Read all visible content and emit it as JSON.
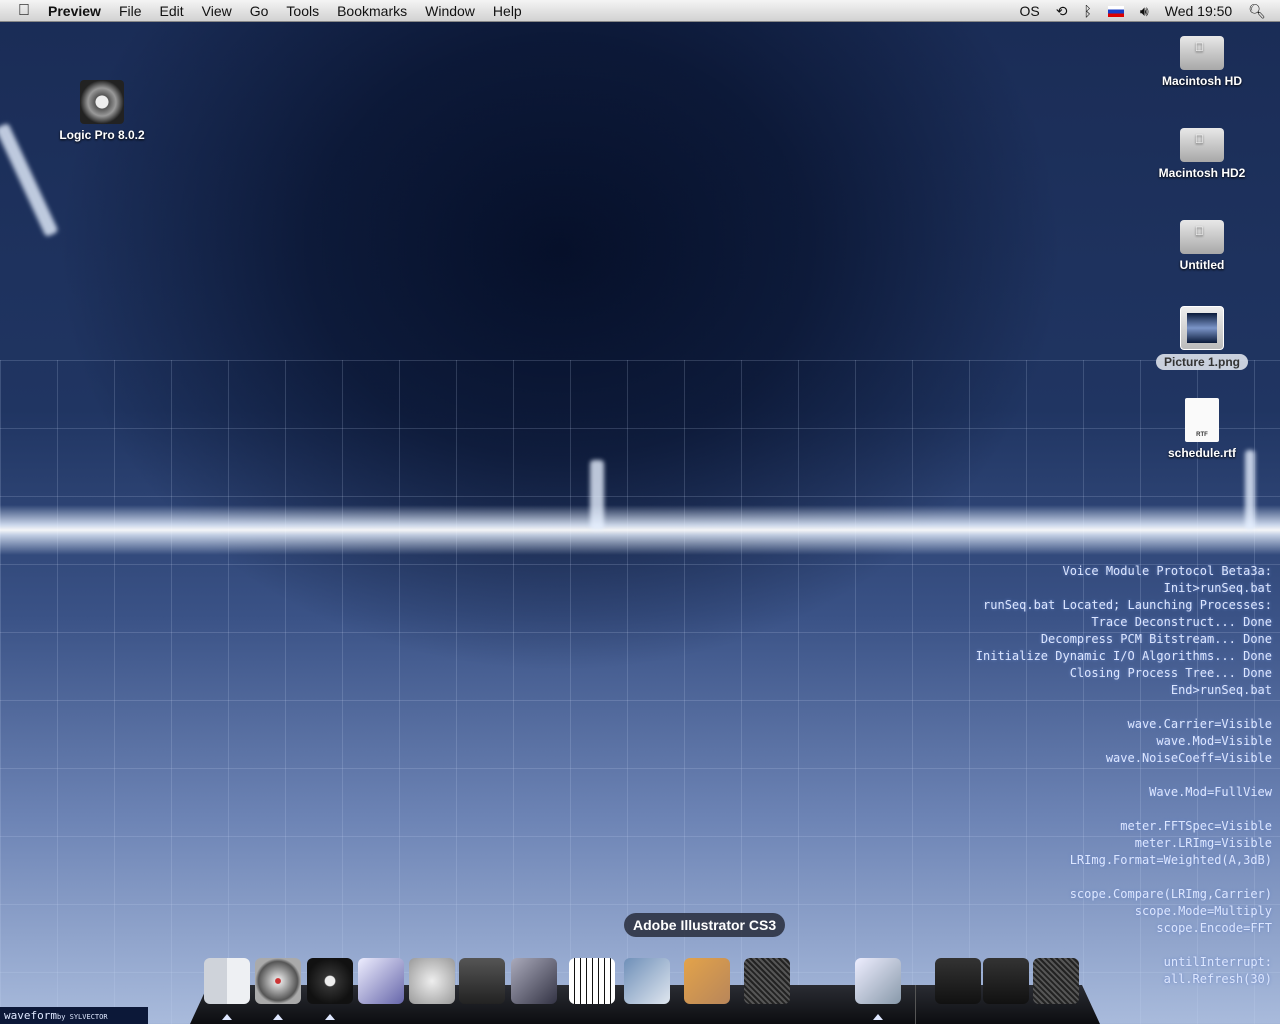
{
  "menubar": {
    "app": "Preview",
    "items": [
      "File",
      "Edit",
      "View",
      "Go",
      "Tools",
      "Bookmarks",
      "Window",
      "Help"
    ],
    "status": {
      "lastfm": "OS",
      "clock": "Wed 19:50"
    },
    "icons": [
      "apple-icon",
      "lastfm-icon",
      "time-machine-icon",
      "bluetooth-icon",
      "flag-slovenia-icon",
      "volume-icon",
      "spotlight-icon"
    ]
  },
  "desktop": {
    "left": [
      {
        "label": "Logic Pro 8.0.2"
      }
    ],
    "right": [
      {
        "label": "Macintosh HD"
      },
      {
        "label": "Macintosh HD2"
      },
      {
        "label": "Untitled"
      },
      {
        "label": "Picture 1.png",
        "selected": true
      },
      {
        "label": "schedule.rtf",
        "badge": "RTF"
      }
    ]
  },
  "wallpaper": {
    "lines": [
      "Voice Module Protocol Beta3a:",
      "Init>runSeq.bat",
      "runSeq.bat Located; Launching Processes:",
      "Trace Deconstruct... Done",
      "Decompress PCM Bitstream... Done",
      "Initialize Dynamic I/O Algorithms... Done",
      "Closing Process Tree... Done",
      "End>runSeq.bat",
      "",
      "wave.Carrier=Visible",
      "wave.Mod=Visible",
      "wave.NoiseCoeff=Visible",
      "",
      "Wave.Mod=FullView",
      "",
      "meter.FFTSpec=Visible",
      "meter.LRImg=Visible",
      "LRImg.Format=Weighted(A,3dB)",
      "",
      "scope.Compare(LRImg,Carrier)",
      "scope.Mode=Multiply",
      "scope.Encode=FFT",
      "",
      "untilInterrupt:",
      "all.Refresh(30)"
    ],
    "brand": "waveform",
    "brand_by": "by SYLVECTOR"
  },
  "dock": {
    "tooltip": "Adobe Illustrator CS3",
    "apps": [
      "finder",
      "safari",
      "dvd-player",
      "guitar-pro-5",
      "flash",
      "logic-pro",
      "mixer",
      "keyboard",
      "photoshop",
      "illustrator",
      "trash-full",
      "preview",
      "utilities-folder",
      "downloads-folder",
      "trash"
    ]
  }
}
